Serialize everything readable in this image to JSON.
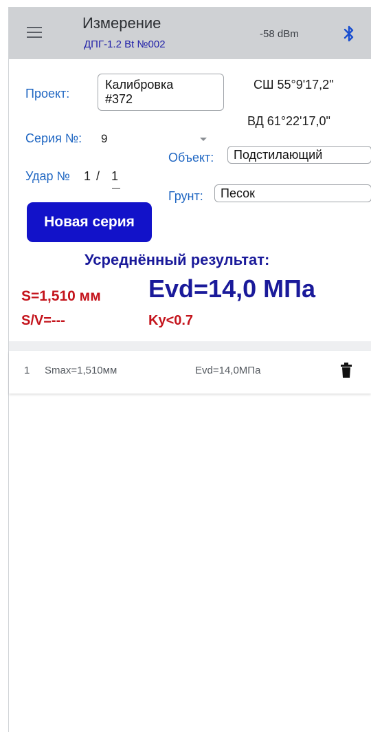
{
  "header": {
    "title": "Измерение",
    "subtitle": "ДПГ-1.2 Bt №002",
    "signal": "-58 dBm",
    "menu_icon": "hamburger-menu-icon",
    "bluetooth_icon": "bluetooth-icon"
  },
  "project": {
    "label": "Проект:",
    "value_line1": "Калибровка",
    "value_line2": "#372"
  },
  "coords": {
    "lat": "СШ 55°9'17,2\"",
    "lon": "ВД 61°22'17,0\""
  },
  "series": {
    "label": "Серия №:",
    "value": "9"
  },
  "hit": {
    "label": "Удар №",
    "current": "1",
    "separator": "/",
    "total": "1"
  },
  "object": {
    "label": "Объект:",
    "value": "Подстилающий"
  },
  "soil": {
    "label": "Грунт:",
    "value": "Песок"
  },
  "new_series_button": "Новая серия",
  "result": {
    "title": "Усреднённый результат:",
    "s": "S=1,510 мм",
    "evd": "Evd=14,0 МПа",
    "sv": "S/V=---",
    "ky": "Ky<0.7"
  },
  "measurements": [
    {
      "index": "1",
      "smax": "Smax=1,510мм",
      "evd": "Evd=14,0МПа"
    }
  ],
  "colors": {
    "appbar": "#cfd1d4",
    "label_blue": "#1f66c2",
    "button": "#1212c9",
    "result_blue": "#1a1a9a",
    "result_red": "#c4141c"
  }
}
